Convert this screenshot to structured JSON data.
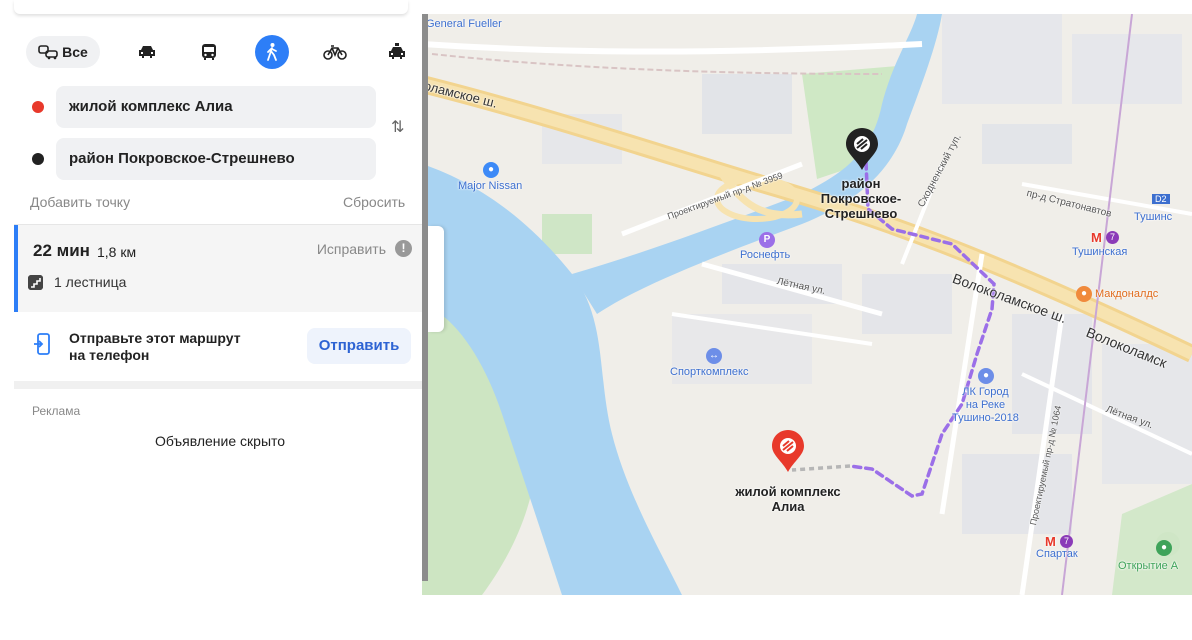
{
  "transport_modes": {
    "all_label": "Все",
    "items": [
      {
        "name": "car-icon",
        "selected": false
      },
      {
        "name": "bus-icon",
        "selected": false
      },
      {
        "name": "walk-icon",
        "selected": true
      },
      {
        "name": "bicycle-icon",
        "selected": false
      },
      {
        "name": "taxi-icon",
        "selected": false
      }
    ]
  },
  "route": {
    "from": "жилой комплекс Алиа",
    "to": "район Покровское-Стрешнево",
    "add_point": "Добавить точку",
    "reset": "Сбросить",
    "from_color": "#e8392b",
    "to_color": "#222222"
  },
  "result": {
    "time": "22 мин",
    "distance": "1,8 км",
    "fix": "Исправить",
    "stairs": "1 лестница",
    "accent_color": "#2d7ef7"
  },
  "send": {
    "text_line1": "Отправьте этот маршрут",
    "text_line2": "на телефон",
    "button": "Отправить"
  },
  "ad": {
    "label": "Реклама",
    "hidden": "Объявление скрыто"
  },
  "map": {
    "labels": {
      "general_fueller": "General Fueller",
      "volokolamskoe_left": "оламское ш.",
      "major_nissan": "Major Nissan",
      "proezd_3959": "Проектируемый пр-д № 3959",
      "rosneft": "Роснефть",
      "letnaya_1": "Лётная ул.",
      "sportkompleks": "Спорткомплекс",
      "pin_to_line1": "район",
      "pin_to_line2": "Покровское-",
      "pin_to_line3": "Стрешнево",
      "skhodnensky": "Сходненский туп.",
      "stratonavtov": "пр-д Стратонавтов",
      "tushinskaya_metro": "Тушинская",
      "tushino_right": "Тушинс",
      "metro_line": "7",
      "d_badge": "D2",
      "mcdonalds": "Макдоналдс",
      "volokolamskoe_main": "Волоколамское ш.",
      "volokolamsk_right": "Волоколамск",
      "gorod_na_reke_1": "ЛК Город",
      "gorod_na_reke_2": "на Реке",
      "gorod_na_reke_3": "Тушино-2018",
      "proezd_1064": "Проектируемый пр-д № 1064",
      "letnaya_2": "Лётная ул.",
      "pin_from_line1": "жилой комплекс",
      "pin_from_line2": "Алиа",
      "spartak": "Спартак",
      "otkrytie": "Открытие А"
    }
  }
}
